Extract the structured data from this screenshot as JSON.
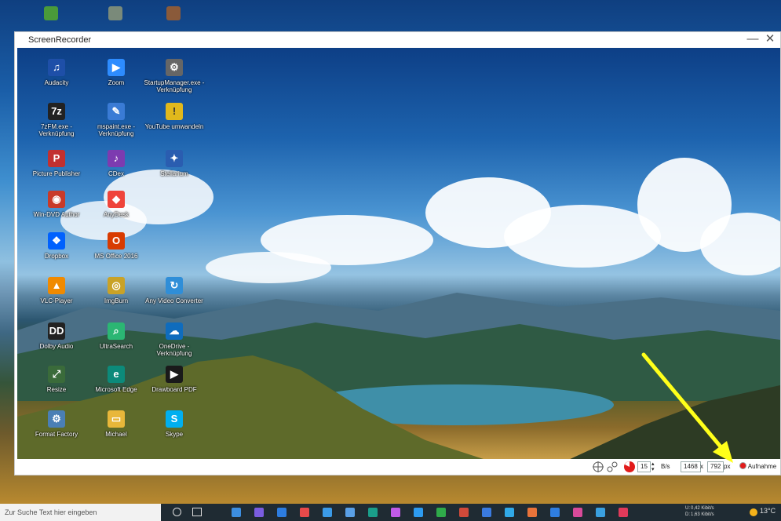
{
  "window": {
    "title": "ScreenRecorder",
    "minimize_glyph": "—",
    "close_glyph": "✕"
  },
  "desktop_icons": [
    {
      "label": "Audacity",
      "icon": "audacity-icon",
      "color": "#1e4fa8"
    },
    {
      "label": "Zoom",
      "icon": "zoom-icon",
      "color": "#2d8cff"
    },
    {
      "label": "StartupManager.exe - Verknüpfung",
      "icon": "gear-icon",
      "color": "#666666"
    },
    {
      "label": "7zFM.exe - Verknüpfung",
      "icon": "7zip-icon",
      "color": "#222222"
    },
    {
      "label": "mspaint.exe - Verknüpfung",
      "icon": "paint-icon",
      "color": "#3a7bd5"
    },
    {
      "label": "YouTube umwandeln",
      "icon": "shield-icon",
      "color": "#e0b81c"
    },
    {
      "label": "Picture Publisher",
      "icon": "picture-publisher-icon",
      "color": "#c23030"
    },
    {
      "label": "CDex",
      "icon": "cdex-icon",
      "color": "#7d3bb0"
    },
    {
      "label": "Stellarium",
      "icon": "stellarium-icon",
      "color": "#2a5db0"
    },
    {
      "label": "Win-DVD Author",
      "icon": "dvd-icon",
      "color": "#c83a2a"
    },
    {
      "label": "AnyDesk",
      "icon": "anydesk-icon",
      "color": "#ef443b"
    },
    {
      "label": "Dropbox",
      "icon": "dropbox-icon",
      "color": "#0061fe"
    },
    {
      "label": "MS Office 2016",
      "icon": "office-icon",
      "color": "#d83b01"
    },
    {
      "label": "VLC-Player",
      "icon": "vlc-icon",
      "color": "#f08a00"
    },
    {
      "label": "ImgBurn",
      "icon": "imgburn-icon",
      "color": "#c9a227"
    },
    {
      "label": "Any Video Converter",
      "icon": "video-converter-icon",
      "color": "#2f8ed8"
    },
    {
      "label": "Dolby Audio",
      "icon": "dolby-icon",
      "color": "#222222"
    },
    {
      "label": "UltraSearch",
      "icon": "ultrasearch-icon",
      "color": "#2bb673"
    },
    {
      "label": "OneDrive - Verknüpfung",
      "icon": "onedrive-icon",
      "color": "#0f6cbd"
    },
    {
      "label": "Resize",
      "icon": "resize-icon",
      "color": "#3a6b3a"
    },
    {
      "label": "Microsoft Edge",
      "icon": "edge-icon",
      "color": "#0c8a7a"
    },
    {
      "label": "Drawboard PDF",
      "icon": "drawboard-icon",
      "color": "#1a1a1a"
    },
    {
      "label": "Format Factory",
      "icon": "format-factory-icon",
      "color": "#4a7fb5"
    },
    {
      "label": "Michael",
      "icon": "folder-icon",
      "color": "#e8b73a"
    },
    {
      "label": "Skype",
      "icon": "skype-icon",
      "color": "#00aff0"
    }
  ],
  "toolbar": {
    "fps_value": "15",
    "fps_unit": "B/s",
    "width_value": "1468",
    "times": "x",
    "height_value": "792",
    "size_unit": "px",
    "record_label": "Aufnahme"
  },
  "taskbar": {
    "search_placeholder": "Zur Suche Text hier eingeben",
    "net_label_up": "U:",
    "net_label_down": "D:",
    "net_up": "0,42 Kibit/s",
    "net_down": "1,63 Kibit/s",
    "temperature": "13°C",
    "pinned_colors": [
      "#3c8ee0",
      "#7a5de0",
      "#2d7de0",
      "#e84a4a",
      "#3b9be8",
      "#5aa0e6",
      "#1a9e8a",
      "#c05be8",
      "#2d9bf0",
      "#2faa4a",
      "#d04a3a",
      "#3a7be0",
      "#31a9e8",
      "#e8733a",
      "#2f7ee0",
      "#d84a9a",
      "#3aa0e0",
      "#e03a5a"
    ]
  }
}
